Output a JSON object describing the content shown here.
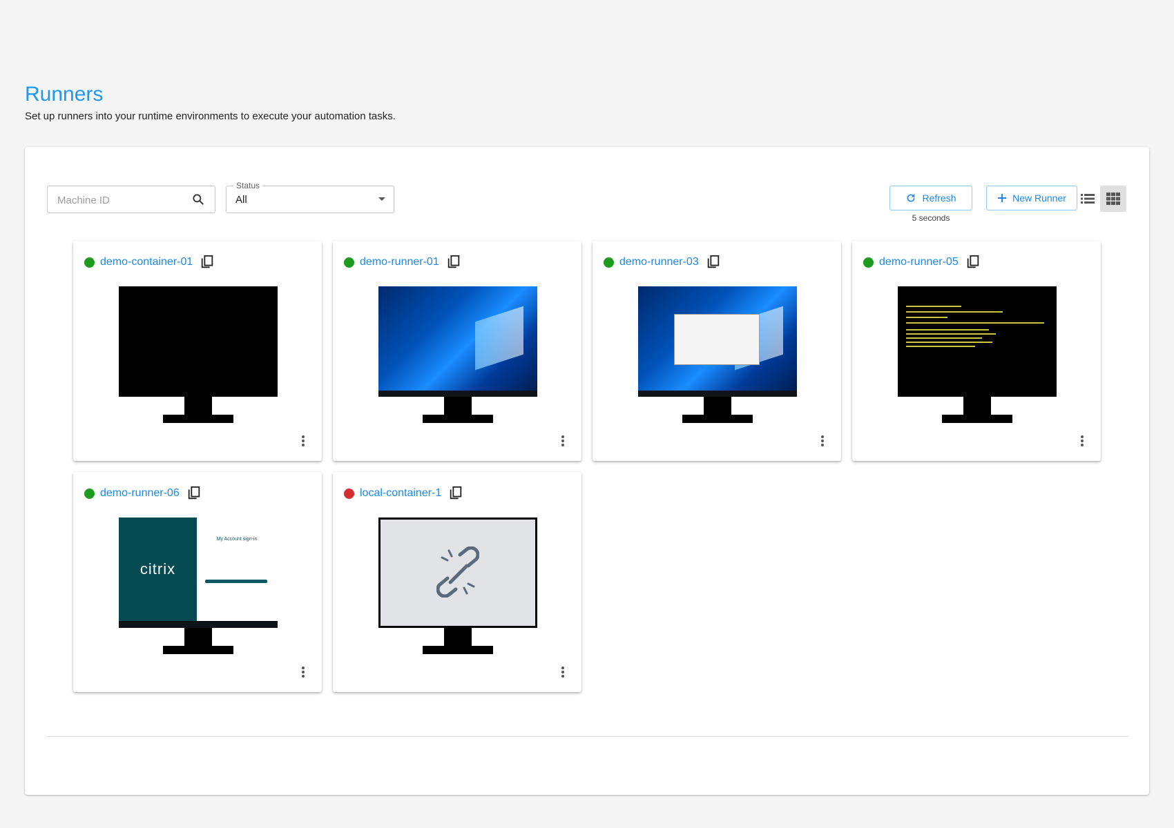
{
  "header": {
    "title": "Runners",
    "subtitle": "Set up runners into your runtime environments to execute your automation tasks."
  },
  "toolbar": {
    "search_placeholder": "Machine ID",
    "status_label": "Status",
    "status_value": "All",
    "refresh_label": "Refresh",
    "refresh_interval": "5 seconds",
    "new_runner_label": "New Runner"
  },
  "colors": {
    "accent": "#2196f3",
    "online": "#1e9a1e",
    "offline": "#d32f2f"
  },
  "runners": [
    {
      "name": "demo-container-01",
      "status": "online",
      "screen": "black"
    },
    {
      "name": "demo-runner-01",
      "status": "online",
      "screen": "windows-desktop"
    },
    {
      "name": "demo-runner-03",
      "status": "online",
      "screen": "windows-desktop-with-dialog"
    },
    {
      "name": "demo-runner-05",
      "status": "online",
      "screen": "terminal"
    },
    {
      "name": "demo-runner-06",
      "status": "online",
      "screen": "citrix-sign-in",
      "screen_text": {
        "logo": "citrix",
        "heading": "My Account sign-in"
      }
    },
    {
      "name": "local-container-1",
      "status": "offline",
      "screen": "disconnected",
      "icon": "broken-link-icon"
    }
  ]
}
